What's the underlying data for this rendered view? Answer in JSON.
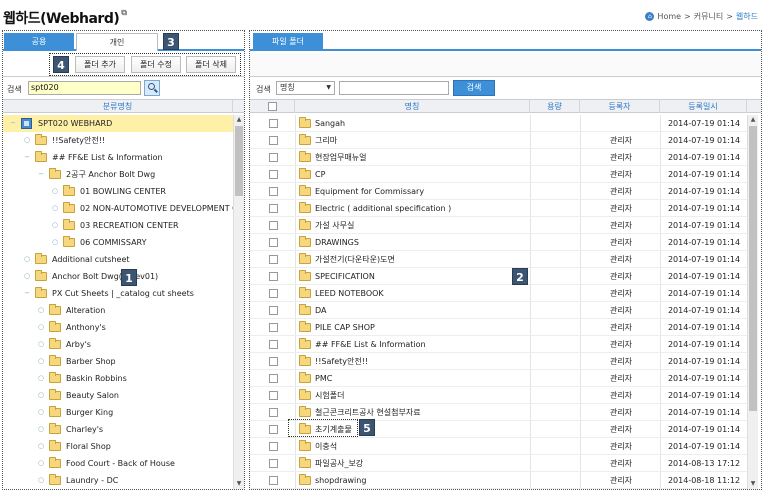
{
  "page": {
    "title": "웹하드(Webhard)"
  },
  "breadcrumb": {
    "items": [
      "Home",
      "커뮤니티",
      "웹하드"
    ],
    "current": "웹하드"
  },
  "left": {
    "tabs": [
      {
        "label": "공용",
        "active": true
      },
      {
        "label": "개인",
        "active": false
      }
    ],
    "buttons": {
      "add": "폴더 추가",
      "edit": "폴더 수정",
      "delete": "폴더 삭제"
    },
    "search": {
      "label": "검색",
      "value": "spt020"
    },
    "column_header": "분류명칭",
    "tree": [
      {
        "label": "SPT020 WEBHARD",
        "depth": 0,
        "root": true,
        "selected": true
      },
      {
        "label": "!!Safety안전!!",
        "depth": 1
      },
      {
        "label": "## FF&E List & Information",
        "depth": 1
      },
      {
        "label": "2공구 Anchor Bolt Dwg",
        "depth": 2
      },
      {
        "label": "01 BOWLING CENTER",
        "depth": 3
      },
      {
        "label": "02 NON-AUTOMOTIVE DEVELOPMENT C",
        "depth": 3
      },
      {
        "label": "03 RECREATION CENTER",
        "depth": 3
      },
      {
        "label": "06 COMMISSARY",
        "depth": 3
      },
      {
        "label": "Additional cutsheet",
        "depth": 1
      },
      {
        "label": "Anchor Bolt Dwg(16rev01)",
        "depth": 1
      },
      {
        "label": "PX Cut Sheets | _catalog cut sheets",
        "depth": 1
      },
      {
        "label": "Alteration",
        "depth": 2
      },
      {
        "label": "Anthony's",
        "depth": 2
      },
      {
        "label": "Arby's",
        "depth": 2
      },
      {
        "label": "Barber Shop",
        "depth": 2
      },
      {
        "label": "Baskin Robbins",
        "depth": 2
      },
      {
        "label": "Beauty Salon",
        "depth": 2
      },
      {
        "label": "Burger King",
        "depth": 2
      },
      {
        "label": "Charley's",
        "depth": 2
      },
      {
        "label": "Floral Shop",
        "depth": 2
      },
      {
        "label": "Food Court - Back of House",
        "depth": 2
      },
      {
        "label": "Laundry - DC",
        "depth": 2
      }
    ]
  },
  "right": {
    "tab": "파일 폴더",
    "search": {
      "label": "검색",
      "select_value": "명칭",
      "input_value": "",
      "button": "검색"
    },
    "columns": {
      "name": "명칭",
      "size": "용량",
      "owner": "등록자",
      "date": "등록일시"
    },
    "files": [
      {
        "name": "Sangah",
        "owner": "",
        "date": "2014-07-19 01:14"
      },
      {
        "name": "그리마",
        "owner": "관리자",
        "date": "2014-07-19 01:14"
      },
      {
        "name": "현장업무매뉴얼",
        "owner": "관리자",
        "date": "2014-07-19 01:14"
      },
      {
        "name": "CP",
        "owner": "관리자",
        "date": "2014-07-19 01:14"
      },
      {
        "name": "Equipment for Commissary",
        "owner": "관리자",
        "date": "2014-07-19 01:14"
      },
      {
        "name": "Electric ( additional specification )",
        "owner": "관리자",
        "date": "2014-07-19 01:14"
      },
      {
        "name": "가설 사무실",
        "owner": "관리자",
        "date": "2014-07-19 01:14"
      },
      {
        "name": "DRAWINGS",
        "owner": "관리자",
        "date": "2014-07-19 01:14"
      },
      {
        "name": "가설전기(다운타운)도면",
        "owner": "관리자",
        "date": "2014-07-19 01:14"
      },
      {
        "name": "SPECIFICATION",
        "owner": "관리자",
        "date": "2014-07-19 01:14"
      },
      {
        "name": "LEED NOTEBOOK",
        "owner": "관리자",
        "date": "2014-07-19 01:14"
      },
      {
        "name": "DA",
        "owner": "관리자",
        "date": "2014-07-19 01:14"
      },
      {
        "name": "PILE CAP SHOP",
        "owner": "관리자",
        "date": "2014-07-19 01:14"
      },
      {
        "name": "## FF&E List & Information",
        "owner": "관리자",
        "date": "2014-07-19 01:14"
      },
      {
        "name": "!!Safety안전!!",
        "owner": "관리자",
        "date": "2014-07-19 01:14"
      },
      {
        "name": "PMC",
        "owner": "관리자",
        "date": "2014-07-19 01:14"
      },
      {
        "name": "시험폴더",
        "owner": "관리자",
        "date": "2014-07-19 01:14"
      },
      {
        "name": "철근콘크리트공사 현설첨부자료",
        "owner": "관리자",
        "date": "2014-07-19 01:14"
      },
      {
        "name": "초기계출물",
        "owner": "관리자",
        "date": "2014-07-19 01:14"
      },
      {
        "name": "이충석",
        "owner": "관리자",
        "date": "2014-07-19 01:14"
      },
      {
        "name": "파일공사_보강",
        "owner": "관리자",
        "date": "2014-08-13 17:12"
      },
      {
        "name": "shopdrawing",
        "owner": "관리자",
        "date": "2014-08-18 11:12"
      }
    ]
  },
  "callouts": [
    "1",
    "2",
    "3",
    "4",
    "5"
  ],
  "colors": {
    "accent": "#3d8fd8",
    "selected_row": "#fff0a8",
    "search_field": "#ffffc8",
    "callout": "#3c5572"
  }
}
